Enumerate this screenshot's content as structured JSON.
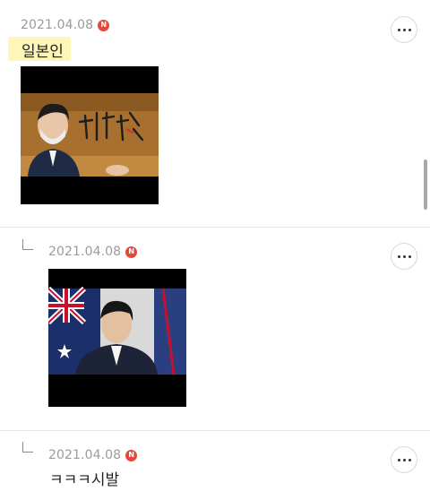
{
  "comments": [
    {
      "date": "2021.04.08",
      "badge": "N",
      "text": "일본인",
      "image_description": "man-in-mask-hokkaido-banner"
    },
    {
      "date": "2021.04.08",
      "badge": "N",
      "is_reply": true,
      "image_description": "man-speaking-flag-background"
    },
    {
      "date": "2021.04.08",
      "badge": "N",
      "is_reply": true,
      "text": "ㅋㅋㅋ시발"
    }
  ],
  "colors": {
    "badge": "#e5483a",
    "highlight": "#fdf6b8",
    "date": "#9b9b9b"
  },
  "icons": {
    "more": "more-horizontal-icon",
    "reply": "reply-arrow-icon",
    "new": "new-badge-icon"
  }
}
